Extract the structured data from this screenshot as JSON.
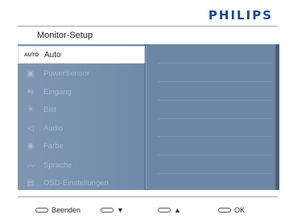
{
  "brand": "PHILIPS",
  "title": "Monitor-Setup",
  "menu": [
    {
      "icon_text": "AUTO",
      "icon": "auto-icon",
      "label": "Auto",
      "active": true
    },
    {
      "icon_text": "▣",
      "icon": "powersensor-icon",
      "label": "PowerSensor",
      "active": false
    },
    {
      "icon_text": "⇋",
      "icon": "input-icon",
      "label": "Eingang",
      "active": false
    },
    {
      "icon_text": "☀",
      "icon": "brightness-icon",
      "label": "Bild",
      "active": false
    },
    {
      "icon_text": "◁",
      "icon": "speaker-icon",
      "label": "Audio",
      "active": false
    },
    {
      "icon_text": "◉",
      "icon": "color-palette-icon",
      "label": "Farbe",
      "active": false
    },
    {
      "icon_text": "〰",
      "icon": "language-icon",
      "label": "Sprache",
      "active": false
    },
    {
      "icon_text": "▤",
      "icon": "osd-settings-icon",
      "label": "OSD-Einstellungen",
      "active": false
    }
  ],
  "footer": {
    "exit_label": "Beenden",
    "down_symbol": "▼",
    "up_symbol": "▲",
    "ok_label": "OK"
  }
}
